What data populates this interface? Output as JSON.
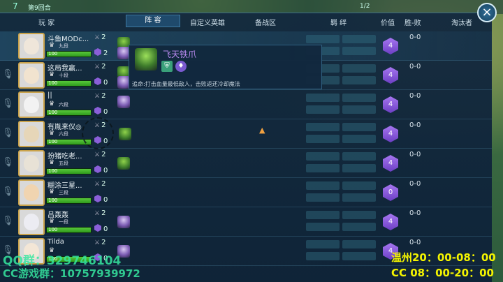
{
  "top_strip": {
    "round": "7",
    "tag": "第9回合",
    "count": "1/2"
  },
  "header": {
    "player": "玩  家",
    "lineup": "阵  容",
    "custom_heroes": "自定义英雄",
    "bench": "备战区",
    "bonds": "羁  绊",
    "value": "价值",
    "win_loss": "胜-败",
    "eliminator": "淘汰者"
  },
  "close_label": "×",
  "players": [
    {
      "name": "斗鱼MODc...",
      "rank": "九段",
      "hp": "100",
      "stat1": "2",
      "stat2": "2",
      "value": "4",
      "score": "0-0"
    },
    {
      "name": "这局我赢...",
      "rank": "十段",
      "hp": "100",
      "stat1": "2",
      "stat2": "0",
      "value": "4",
      "score": "0-0"
    },
    {
      "name": "||",
      "rank": "六段",
      "hp": "100",
      "stat1": "2",
      "stat2": "0",
      "value": "4",
      "score": "0-0"
    },
    {
      "name": "有胤来仪◎",
      "rank": "六段",
      "hp": "100",
      "stat1": "2",
      "stat2": "0",
      "value": "4",
      "score": "0-0"
    },
    {
      "name": "扮猪吃老...",
      "rank": "五段",
      "hp": "100",
      "stat1": "2",
      "stat2": "0",
      "value": "4",
      "score": "0-0"
    },
    {
      "name": "糊涂三星...",
      "rank": "三段",
      "hp": "100",
      "stat1": "2",
      "stat2": "0",
      "value": "0",
      "score": "0-0"
    },
    {
      "name": "吕轰轰",
      "rank": "一段",
      "hp": "100",
      "stat1": "2",
      "stat2": "0",
      "value": "4",
      "score": "0-0"
    },
    {
      "name": "Tilda",
      "rank": "",
      "hp": "100",
      "stat1": "2",
      "stat2": "0",
      "value": "4",
      "score": "0-0"
    }
  ],
  "tooltip": {
    "name": "飞天铁爪",
    "desc": "追命:打击血量最低敌人，击败返还冷却魔法"
  },
  "watermark": {
    "qq": "QQ群：329746104",
    "cc": "CC游戏群：10757939972",
    "line1": "温州20：00-08：00",
    "line2": "CC 08：00-20：00"
  },
  "colors": {
    "accent_purple": "#8a5fd8",
    "hp_green": "#58c83a",
    "watermark_yellow": "#f4f400",
    "watermark_green": "#36e6a0"
  }
}
